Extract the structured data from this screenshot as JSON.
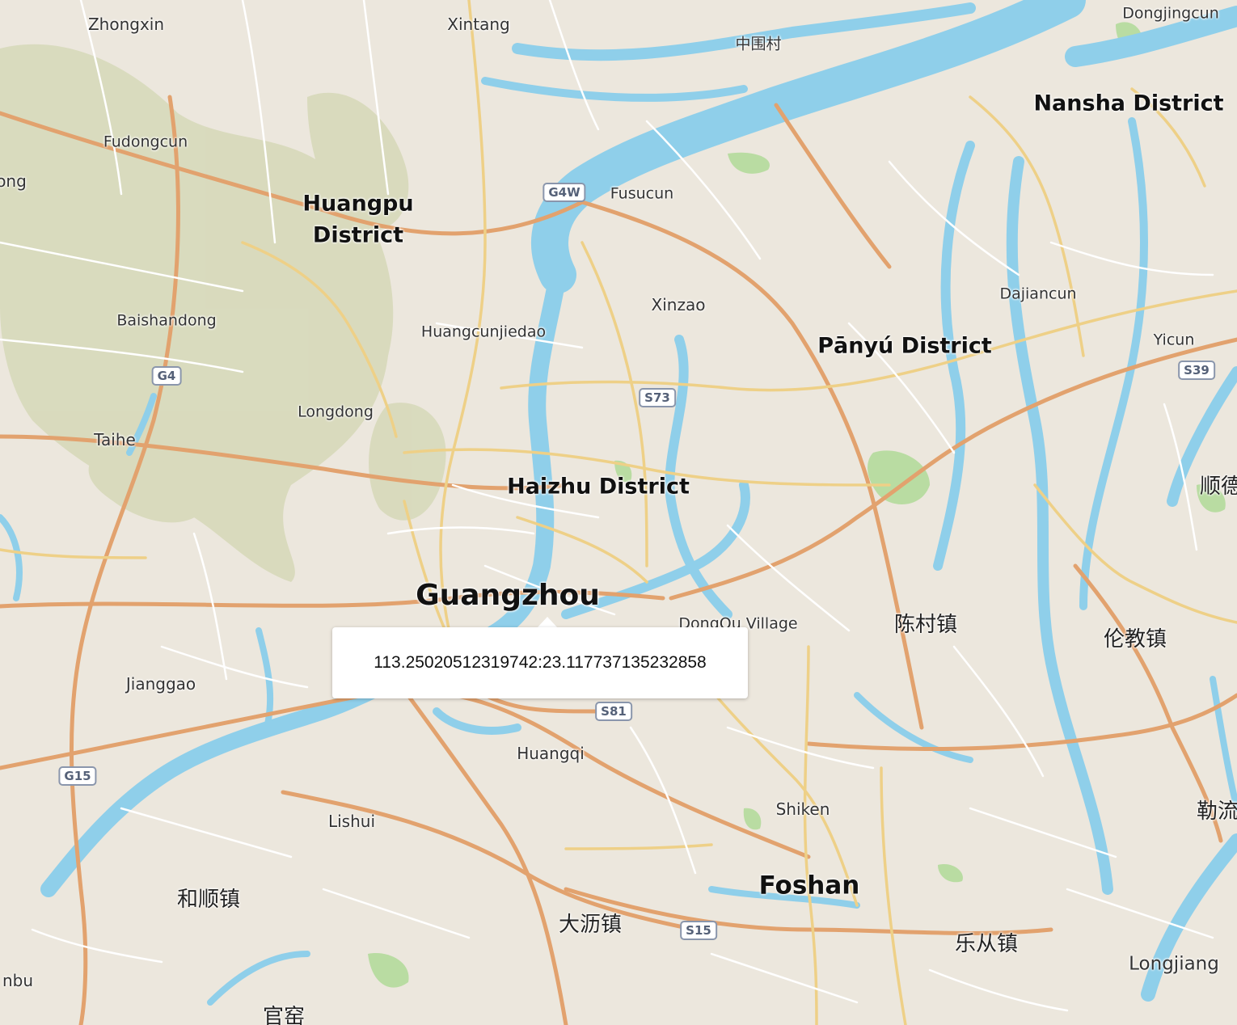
{
  "map": {
    "popup": {
      "coordinate_text": "113.25020512319742:23.117737135232858"
    },
    "labels": {
      "zhongxin": "Zhongxin",
      "xintang": "Xintang",
      "zhongweicun": "中围村",
      "dongjingcun": "Dongjingcun",
      "nansha": "Nansha District",
      "fudongcun": "Fudongcun",
      "ong": "ong",
      "huangpu_1": "Huangpu",
      "huangpu_2": "District",
      "fusucun": "Fusucun",
      "dajiancun": "Dajiancun",
      "xinzao": "Xinzao",
      "baishandong": "Baishandong",
      "huangcunjiedao": "Huangcunjiedao",
      "panyu": "Pānyú District",
      "yicun": "Yicun",
      "longdong": "Longdong",
      "taihe": "Taihe",
      "haizhu": "Haizhu District",
      "shun": "顺德",
      "guangzhou": "Guangzhou",
      "dongqu": "DongQu Village",
      "chencun": "陈村镇",
      "lunjiao": "伦教镇",
      "jianggao": "Jianggao",
      "huangqi": "Huangqi",
      "leliu": "勒流",
      "shiken": "Shiken",
      "lishui": "Lishui",
      "foshan": "Foshan",
      "heshun": "和顺镇",
      "dali": "大沥镇",
      "lecong": "乐从镇",
      "longjiang": "Longjiang",
      "nbu": "nbu",
      "guanyao": "官窑"
    },
    "shields": {
      "g4w": "G4W",
      "g4": "G4",
      "s73": "S73",
      "s39": "S39",
      "s81": "S81",
      "g15": "G15",
      "s15": "S15"
    },
    "colors": {
      "land": "#ece7dd",
      "water": "#8fcfea",
      "park": "#b8dca0",
      "hills": "#d3d6b4",
      "major_road": "#e2a26e",
      "secondary_road": "#eed087",
      "minor_road": "#ffffff",
      "shield_border": "#8a96ac"
    }
  }
}
